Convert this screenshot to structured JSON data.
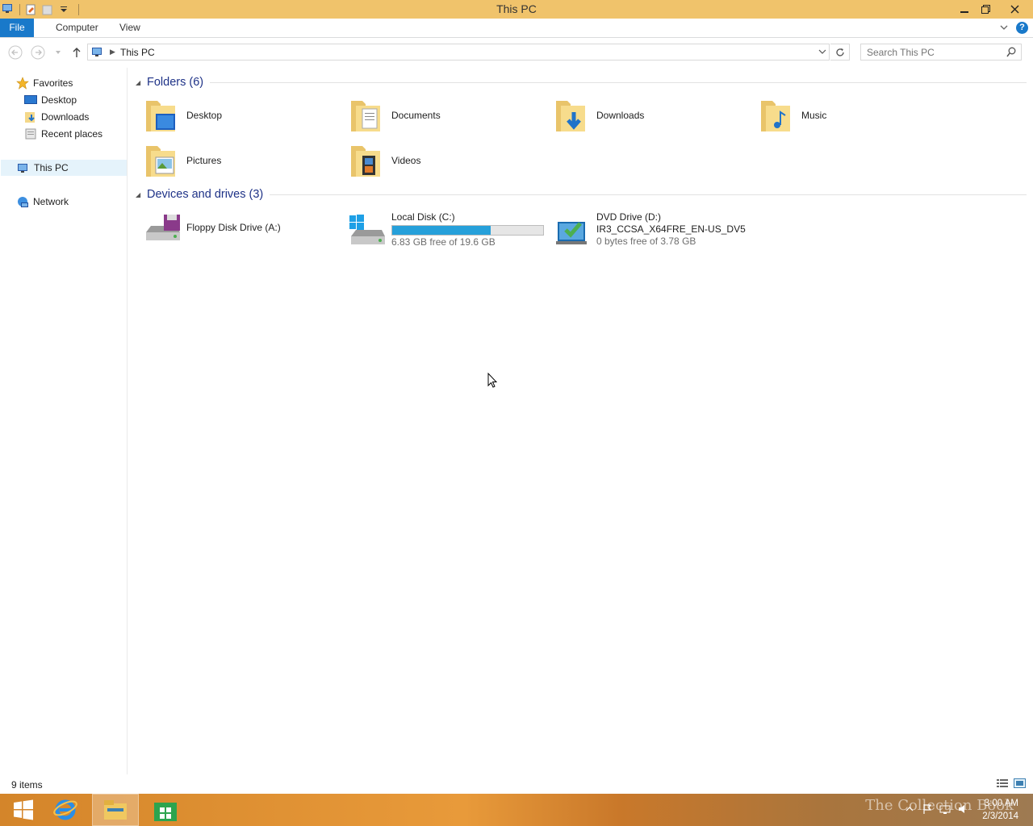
{
  "window": {
    "title": "This PC"
  },
  "ribbon": {
    "tabs": [
      "File",
      "Computer",
      "View"
    ],
    "help": "?"
  },
  "address": {
    "location": "This PC",
    "search_placeholder": "Search This PC"
  },
  "nav": {
    "favorites_label": "Favorites",
    "favorites": [
      "Desktop",
      "Downloads",
      "Recent places"
    ],
    "this_pc": "This PC",
    "network": "Network"
  },
  "folders": {
    "header": "Folders (6)",
    "items": [
      {
        "label": "Desktop",
        "icon": "desktop-folder-icon"
      },
      {
        "label": "Documents",
        "icon": "documents-folder-icon"
      },
      {
        "label": "Downloads",
        "icon": "downloads-folder-icon"
      },
      {
        "label": "Music",
        "icon": "music-folder-icon"
      },
      {
        "label": "Pictures",
        "icon": "pictures-folder-icon"
      },
      {
        "label": "Videos",
        "icon": "videos-folder-icon"
      }
    ]
  },
  "drives": {
    "header": "Devices and drives (3)",
    "items": [
      {
        "name": "Floppy Disk Drive (A:)"
      },
      {
        "name": "Local Disk (C:)",
        "free": "6.83 GB free of 19.6 GB",
        "used_fraction": 0.65
      },
      {
        "name": "DVD Drive (D:)",
        "volume": "IR3_CCSA_X64FRE_EN-US_DV5",
        "free": "0 bytes free of 3.78 GB"
      }
    ]
  },
  "status": {
    "count": "9 items"
  },
  "taskbar": {
    "clock_time": "3:00 AM",
    "clock_date": "2/3/2014",
    "watermark": "The Collection Book"
  },
  "colors": {
    "accent": "#1979ca",
    "titlebar": "#f0c36b",
    "header_text": "#1e3287",
    "drive_bar": "#26a0da"
  }
}
